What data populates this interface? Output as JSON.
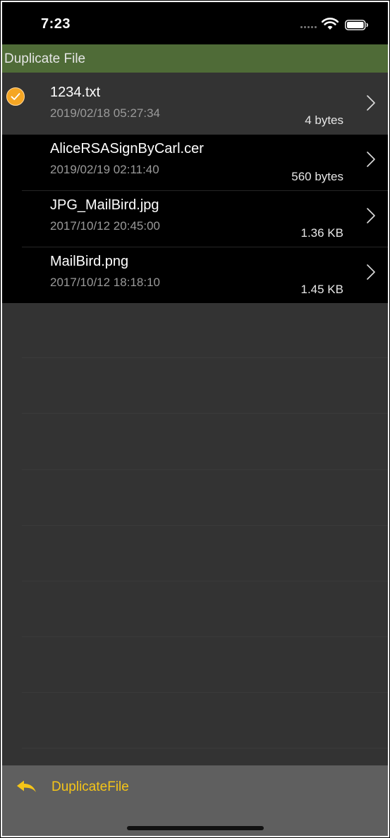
{
  "status_bar": {
    "time": "7:23",
    "icons": [
      "cellular-dots-icon",
      "wifi-icon",
      "battery-icon"
    ]
  },
  "title_bar": {
    "title": "Duplicate File",
    "color": "#4f6b37"
  },
  "files": [
    {
      "name": "1234.txt",
      "date": "2019/02/18  05:27:34",
      "size": "4 bytes",
      "selected": true
    },
    {
      "name": "AliceRSASignByCarl.cer",
      "date": "2019/02/19  02:11:40",
      "size": "560 bytes",
      "selected": false
    },
    {
      "name": "JPG_MailBird.jpg",
      "date": "2017/10/12  20:45:00",
      "size": "1.36 KB",
      "selected": false
    },
    {
      "name": "MailBird.png",
      "date": "2017/10/12  18:18:10",
      "size": "1.45 KB",
      "selected": false
    }
  ],
  "toolbar": {
    "back_label": "DuplicateFile",
    "accent_color": "#f5c518"
  },
  "colors": {
    "selection_check": "#f5a623",
    "background": "#333333"
  }
}
